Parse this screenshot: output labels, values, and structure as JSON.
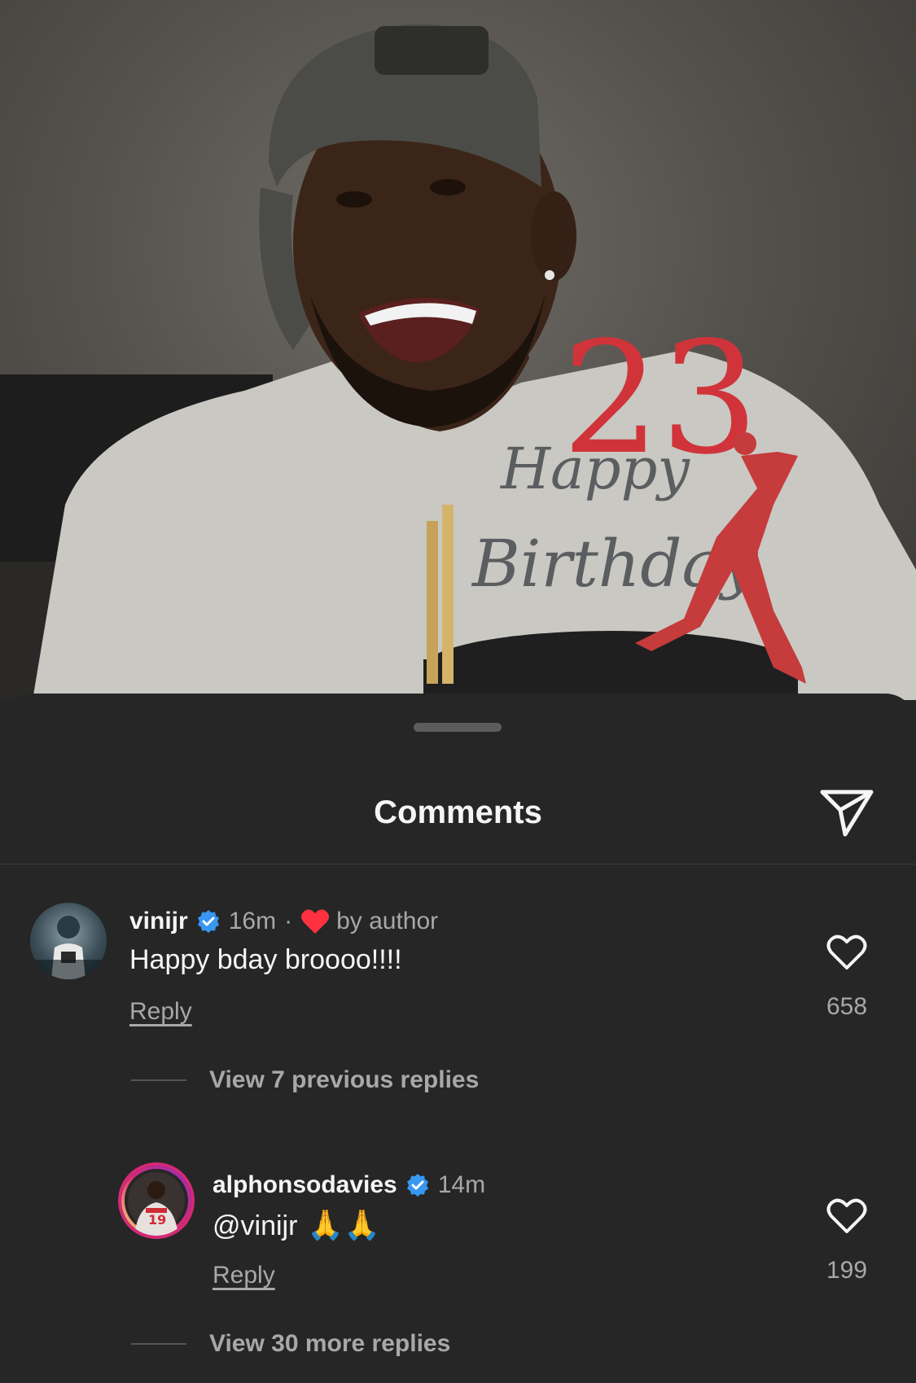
{
  "sheet": {
    "title": "Comments",
    "share_icon": "paper-plane-icon"
  },
  "comments": [
    {
      "username": "vinijr",
      "verified": true,
      "time": "16m",
      "separator": "·",
      "liked_by_author": "by author",
      "text": "Happy bday broooo!!!!",
      "reply_label": "Reply",
      "likes": "658",
      "view_replies": "View 7 previous replies"
    },
    {
      "username": "alphonsodavies",
      "verified": true,
      "time": "14m",
      "text": "@vinijr",
      "emoji": "🙏🙏",
      "reply_label": "Reply",
      "likes": "199",
      "view_replies": "View 30 more replies"
    }
  ],
  "photo": {
    "cake_topper_number": "23",
    "cake_topper_text": "Happy Birthday"
  },
  "colors": {
    "background": "#262626",
    "verified_blue": "#3897f0",
    "heart_red": "#ff3040",
    "muted_text": "#a8a8a8"
  }
}
